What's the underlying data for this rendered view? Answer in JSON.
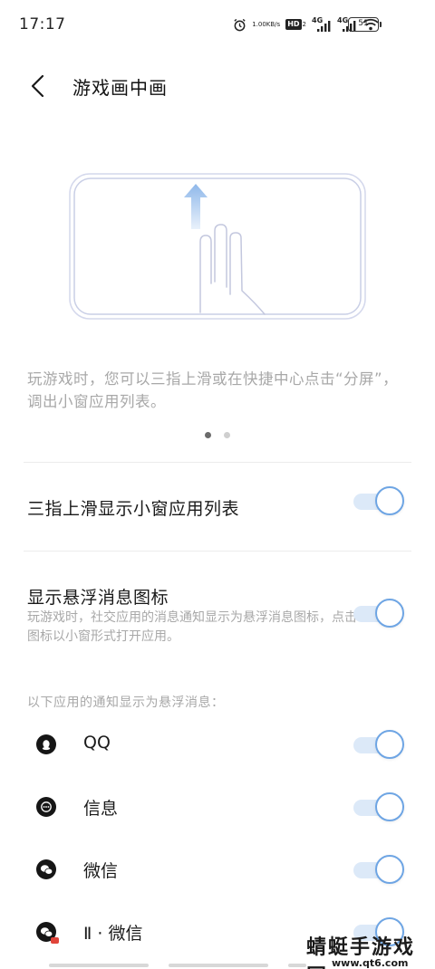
{
  "status_bar": {
    "time": "17:17",
    "net_speed_value": "1.00",
    "net_speed_unit": "KB/s",
    "hd_label": "HD",
    "hd_sub": "2",
    "signal1_label": "4G",
    "signal2_label": "4G",
    "battery_level": "51",
    "icons": [
      "alarm-icon",
      "hd-volte-icon",
      "signal-4g-icon",
      "signal-4g-icon",
      "wifi-icon",
      "battery-icon"
    ]
  },
  "header": {
    "title": "游戏画中画",
    "back_icon": "chevron-left-icon"
  },
  "guide": {
    "description": "玩游戏时，您可以三指上滑或在快捷中心点击“分屏”，调出小窗应用列表。",
    "page_count": 2,
    "active_page": 1
  },
  "settings": {
    "three_finger": {
      "label": "三指上滑显示小窗应用列表",
      "enabled": true
    },
    "floating_icon": {
      "label": "显示悬浮消息图标",
      "description": "玩游戏时，社交应用的消息通知显示为悬浮消息图标，点击图标以小窗形式打开应用。",
      "enabled": true
    }
  },
  "apps_section": {
    "note": "以下应用的通知显示为悬浮消息：",
    "apps": [
      {
        "label": "QQ",
        "icon": "qq-icon",
        "enabled": true
      },
      {
        "label": "信息",
        "icon": "messages-icon",
        "enabled": true
      },
      {
        "label": "微信",
        "icon": "wechat-icon",
        "enabled": true
      },
      {
        "label": "Ⅱ · 微信",
        "icon": "wechat-clone-icon",
        "enabled": true
      }
    ]
  },
  "watermark": {
    "text": "蜻蜓手游戏网",
    "url": "www.qt6.com"
  },
  "colors": {
    "accent": "#6ea5e4",
    "toggle_track": "#dce9f8",
    "secondary_text": "#a8a8a8"
  }
}
